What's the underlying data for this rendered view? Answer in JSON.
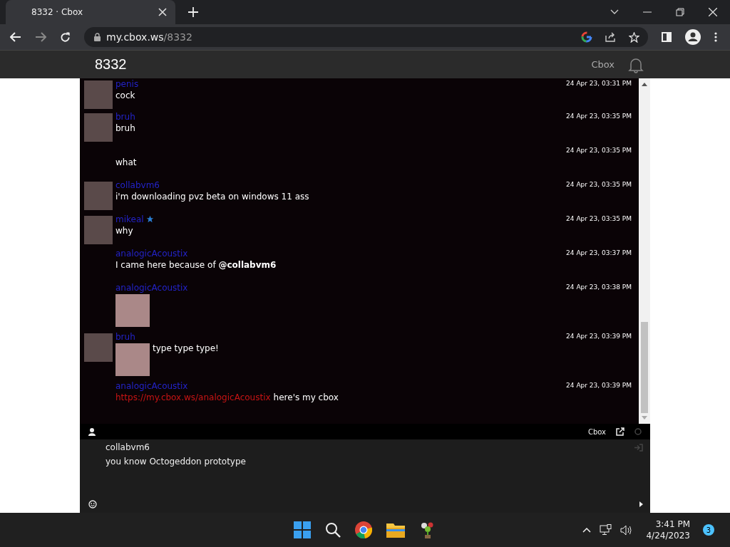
{
  "browser": {
    "tab_title": "8332 · Cbox",
    "url_host": "my.cbox.ws",
    "url_path": "/8332"
  },
  "header": {
    "title": "8332",
    "brand": "Cbox"
  },
  "messages": [
    {
      "avatar": true,
      "name": "penis",
      "time": "24 Apr 23, 03:31 PM",
      "text": "cock"
    },
    {
      "avatar": true,
      "name": "bruh",
      "time": "24 Apr 23, 03:35 PM",
      "text": "bruh"
    },
    {
      "time": "24 Apr 23, 03:35 PM",
      "text": "what"
    },
    {
      "avatar": true,
      "name": "collabvm6",
      "time": "24 Apr 23, 03:35 PM",
      "text": "i'm downloading pvz beta on windows 11 ass"
    },
    {
      "avatar": true,
      "name": "mikeal",
      "verified": true,
      "time": "24 Apr 23, 03:35 PM",
      "text": "why"
    },
    {
      "name": "analogicAcoustix",
      "time": "24 Apr 23, 03:37 PM",
      "text": "I came here because of **@collabvm6**"
    },
    {
      "name": "analogicAcoustix",
      "time": "24 Apr 23, 03:38 PM",
      "image": true
    },
    {
      "avatar": true,
      "name": "bruh",
      "time": "24 Apr 23, 03:39 PM",
      "text": "type type type!",
      "image": true
    },
    {
      "name": "analogicAcoustix",
      "time": "24 Apr 23, 03:39 PM",
      "link": "https://my.cbox.ws/analogicAcoustix",
      "text": "here's my cbox"
    }
  ],
  "footer_bar": {
    "brand": "Cbox"
  },
  "composer": {
    "username": "collabvm6",
    "value": "you know Octogeddon prototype"
  },
  "taskbar": {
    "time": "3:41 PM",
    "date": "4/24/2023",
    "badge": "3"
  }
}
